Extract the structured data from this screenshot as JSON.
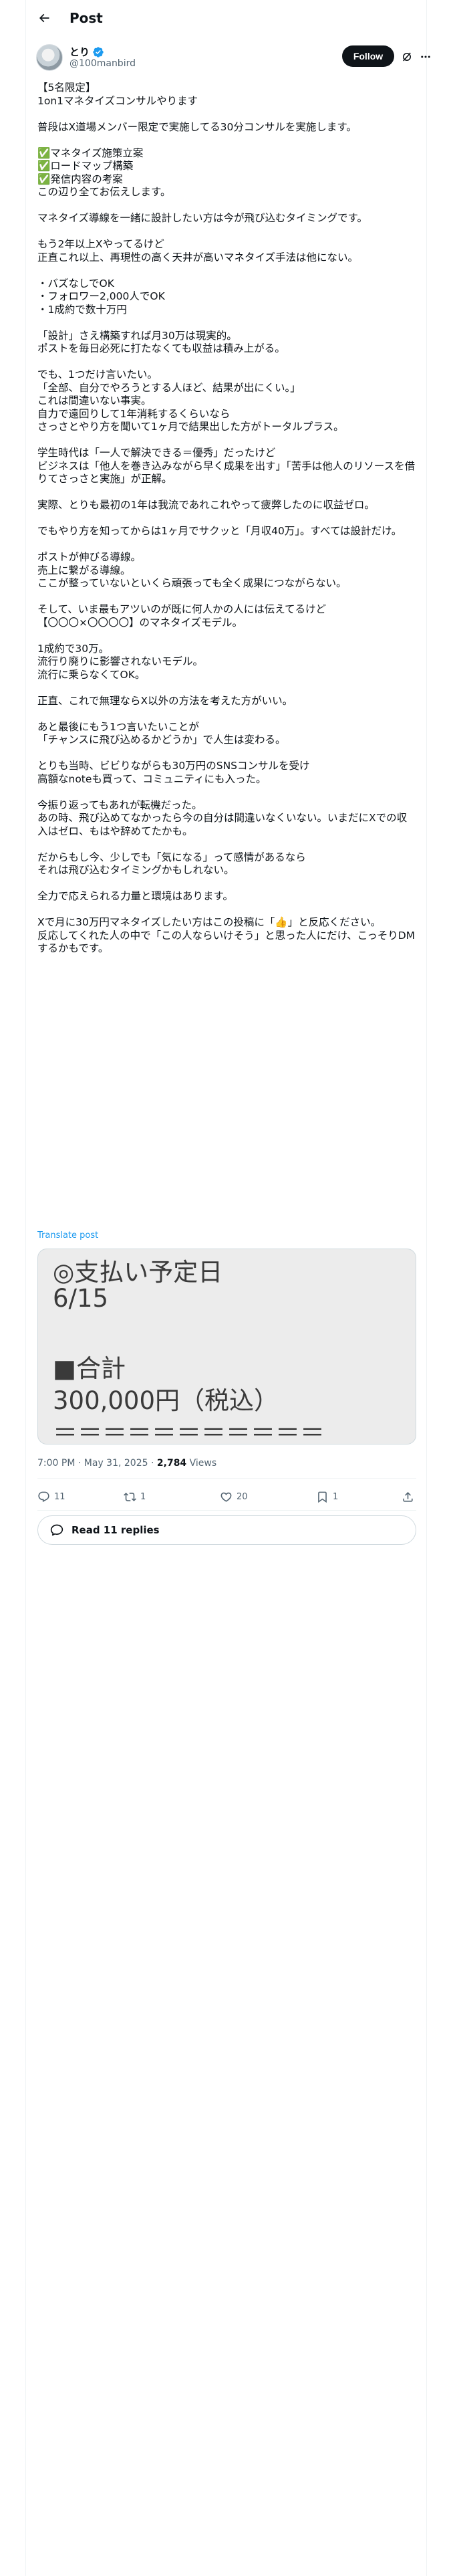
{
  "header": {
    "title": "Post"
  },
  "author": {
    "name": "とり",
    "handle": "@100manbird",
    "follow_label": "Follow"
  },
  "tweet": {
    "lines": [
      "【5名限定】",
      "1on1マネタイズコンサルやります",
      "",
      "普段はX道場メンバー限定で実施してる30分コンサルを実施します。",
      "",
      "✅マネタイズ施策立案",
      "✅ロードマップ構築",
      "✅発信内容の考案",
      "この辺り全てお伝えします。",
      "",
      "マネタイズ導線を一緒に設計したい方は今が飛び込むタイミングです。",
      "",
      "もう2年以上Xやってるけど",
      "正直これ以上、再現性の高く天井が高いマネタイズ手法は他にない。",
      "",
      "・バズなしでOK",
      "・フォロワー2,000人でOK",
      "・1成約で数十万円",
      "",
      "「設計」さえ構築すれば月30万は現実的。",
      "ポストを毎日必死に打たなくても収益は積み上がる。",
      "",
      "でも、1つだけ言いたい。",
      "「全部、自分でやろうとする人ほど、結果が出にくい。」",
      "これは間違いない事実。",
      "自力で遠回りして1年消耗するくらいなら",
      "さっさとやり方を聞いて1ヶ月で結果出した方がトータルプラス。",
      "",
      "学生時代は「一人で解決できる＝優秀」だったけど",
      "ビジネスは「他人を巻き込みながら早く成果を出す」「苦手は他人のリソースを借りてさっさと実施」が正解。",
      "",
      "実際、とりも最初の1年は我流であれこれやって疲弊したのに収益ゼロ。",
      "",
      "でもやり方を知ってからは1ヶ月でサクッと「月収40万」。すべては設計だけ。",
      "",
      "ポストが伸びる導線。",
      "売上に繋がる導線。",
      "ここが整っていないといくら頑張っても全く成果につながらない。",
      "",
      "そして、いま最もアツいのが既に何人かの人には伝えてるけど",
      "【〇〇〇×〇〇〇〇】のマネタイズモデル。",
      "",
      "1成約で30万。",
      "流行り廃りに影響されないモデル。",
      "流行に乗らなくてOK。",
      "",
      "正直、これで無理ならX以外の方法を考えた方がいい。",
      "",
      "あと最後にもう1つ言いたいことが",
      "「チャンスに飛び込めるかどうか」で人生は変わる。",
      "",
      "とりも当時、ビビりながらも30万円のSNSコンサルを受け",
      "高額なnoteも買って、コミュニティにも入った。",
      "",
      "今振り返ってもあれが転機だった。",
      "あの時、飛び込めてなかったら今の自分は間違いなくいない。いまだにXでの収入はゼロ、もはや辞めてたかも。",
      "",
      "だからもし今、少しでも「気になる」って感情があるなら",
      "それは飛び込むタイミングかもしれない。",
      "",
      "全力で応えられる力量と環境はあります。",
      "",
      "Xで月に30万円マネタイズしたい方はこの投稿に「👍」と反応ください。",
      "反応してくれた人の中で「この人ならいけそう」と思った人にだけ、こっそりDMするかもです。"
    ],
    "translate_label": "Translate post"
  },
  "media": {
    "lines": [
      "◎支払い予定日",
      "6/15",
      "",
      "■合計",
      "300,000円（税込）",
      "＝＝＝＝＝＝＝＝＝＝＝"
    ]
  },
  "meta": {
    "time": "7:00 PM",
    "separator": " · ",
    "date": "May 31, 2025",
    "views_count": "2,784",
    "views_label": " Views"
  },
  "actions": {
    "reply_count": "11",
    "repost_count": "1",
    "like_count": "20",
    "bookmark_count": "1"
  },
  "replies": {
    "label": "Read 11 replies"
  },
  "colors": {
    "accent": "#1d9bf0",
    "text": "#0f1419",
    "secondary": "#536471",
    "border": "#cfd9de",
    "verified": "#1d9bf0"
  },
  "icons": {
    "back": "arrow-left-icon",
    "verified": "verified-badge-icon",
    "grok": "grok-icon",
    "more": "more-horizontal-icon",
    "reply": "reply-icon",
    "repost": "repost-icon",
    "like": "heart-icon",
    "bookmark": "bookmark-icon",
    "share": "share-icon",
    "replies": "chat-bubble-icon"
  }
}
